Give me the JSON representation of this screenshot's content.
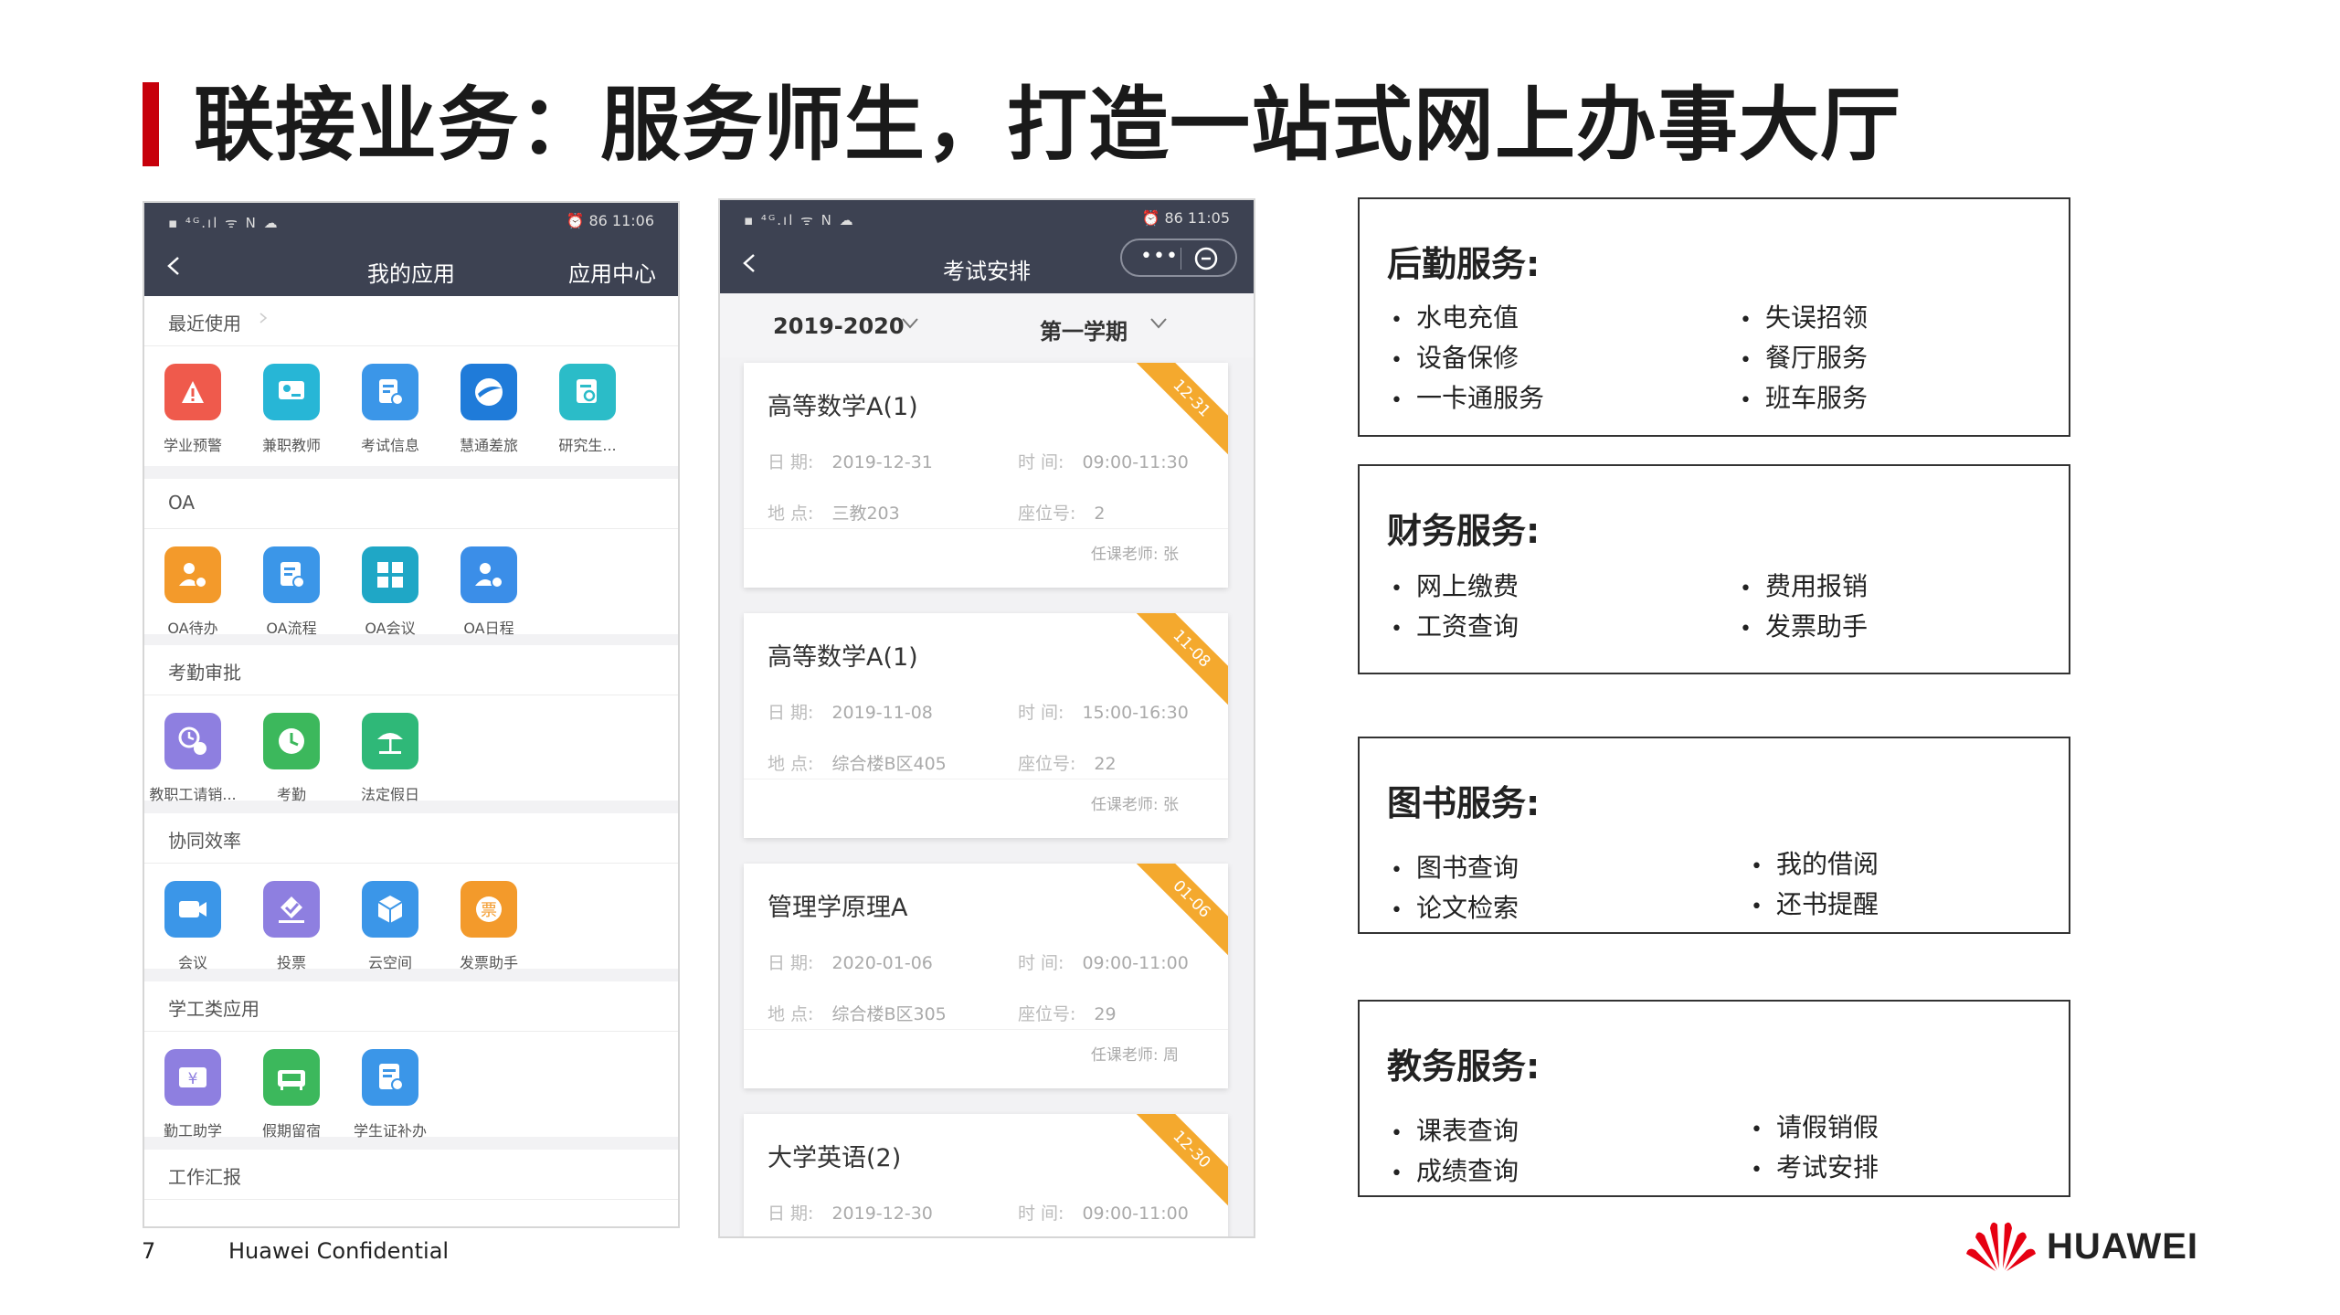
{
  "slide": {
    "title": "联接业务：服务师生，打造一站式网上办事大厅",
    "page_number": "7",
    "confidential": "Huawei Confidential",
    "logo_text": "HUAWEI",
    "accent_color": "#c7000b"
  },
  "phone1": {
    "status_left": "▪ ⁴ᴳ.ıl ᯤ N ☁",
    "status_right": "⏰ 86 11:06",
    "title": "我的应用",
    "right_link": "应用中心",
    "sections": [
      {
        "title": "最近使用",
        "apps": [
          {
            "label": "学业预警",
            "icon": "alarm-icon",
            "color": "#ef5a4c"
          },
          {
            "label": "兼职教师",
            "icon": "teacher-board-icon",
            "color": "#27b6d6"
          },
          {
            "label": "考试信息",
            "icon": "exam-info-icon",
            "color": "#3b96e8"
          },
          {
            "label": "慧通差旅",
            "icon": "airplane-icon",
            "color": "#1f7bd9"
          },
          {
            "label": "研究生...",
            "icon": "search-document-icon",
            "color": "#2bbcc8"
          }
        ]
      },
      {
        "title": "OA",
        "apps": [
          {
            "label": "OA待办",
            "icon": "user-todo-icon",
            "color": "#f39a2b"
          },
          {
            "label": "OA流程",
            "icon": "process-icon",
            "color": "#3b96e8"
          },
          {
            "label": "OA会议",
            "icon": "grid-icon",
            "color": "#1fa7c6"
          },
          {
            "label": "OA日程",
            "icon": "user-schedule-icon",
            "color": "#3b8ee8"
          }
        ]
      },
      {
        "title": "考勤审批",
        "apps": [
          {
            "label": "教职工请销...",
            "icon": "leave-icon",
            "color": "#8e7fe0"
          },
          {
            "label": "考勤",
            "icon": "clock-icon",
            "color": "#3cb85c"
          },
          {
            "label": "法定假日",
            "icon": "beach-icon",
            "color": "#2fb878"
          }
        ]
      },
      {
        "title": "协同效率",
        "apps": [
          {
            "label": "会议",
            "icon": "video-icon",
            "color": "#3b96e8"
          },
          {
            "label": "投票",
            "icon": "vote-icon",
            "color": "#8e7fe0"
          },
          {
            "label": "云空间",
            "icon": "cube-icon",
            "color": "#3b96e8"
          },
          {
            "label": "发票助手",
            "icon": "ticket-icon",
            "color": "#f39a2b"
          }
        ]
      },
      {
        "title": "学工类应用",
        "apps": [
          {
            "label": "勤工助学",
            "icon": "money-icon",
            "color": "#8e7fe0"
          },
          {
            "label": "假期留宿",
            "icon": "bed-icon",
            "color": "#3cb85c"
          },
          {
            "label": "学生证补办",
            "icon": "card-icon",
            "color": "#3b96e8"
          }
        ]
      },
      {
        "title": "工作汇报",
        "apps": []
      }
    ]
  },
  "phone2": {
    "status_left": "▪ ⁴ᴳ.ıl ᯤ N ☁",
    "status_right": "⏰ 86 11:05",
    "title": "考试安排",
    "menu_dots": "•••",
    "year": "2019-2020",
    "term": "第一学期",
    "date_label": "日  期:",
    "time_label": "时  间:",
    "place_label": "地  点:",
    "seat_label": "座位号:",
    "teacher_label": "任课老师:",
    "exams": [
      {
        "name": "高等数学A(1)",
        "ribbon": "12-31",
        "date": "2019-12-31",
        "time": "09:00-11:30",
        "place": "三教203",
        "seat": "2",
        "teacher": "张"
      },
      {
        "name": "高等数学A(1)",
        "ribbon": "11-08",
        "date": "2019-11-08",
        "time": "15:00-16:30",
        "place": "综合楼B区405",
        "seat": "22",
        "teacher": "张"
      },
      {
        "name": "管理学原理A",
        "ribbon": "01-06",
        "date": "2020-01-06",
        "time": "09:00-11:00",
        "place": "综合楼B区305",
        "seat": "29",
        "teacher": "周"
      },
      {
        "name": "大学英语(2)",
        "ribbon": "12-30",
        "date": "2019-12-30",
        "time": "09:00-11:00",
        "place": "",
        "seat": "",
        "teacher": ""
      }
    ]
  },
  "services": [
    {
      "title": "后勤服务:",
      "left": [
        "水电充值",
        "设备保修",
        "一卡通服务"
      ],
      "right": [
        "失误招领",
        "餐厅服务",
        "班车服务"
      ]
    },
    {
      "title": "财务服务:",
      "left": [
        "网上缴费",
        "工资查询"
      ],
      "right": [
        "费用报销",
        "发票助手"
      ]
    },
    {
      "title": "图书服务:",
      "left": [
        "图书查询",
        "论文检索"
      ],
      "right": [
        "我的借阅",
        "还书提醒"
      ]
    },
    {
      "title": "教务服务:",
      "left": [
        "课表查询",
        "成绩查询"
      ],
      "right": [
        "请假销假",
        "考试安排"
      ]
    }
  ]
}
